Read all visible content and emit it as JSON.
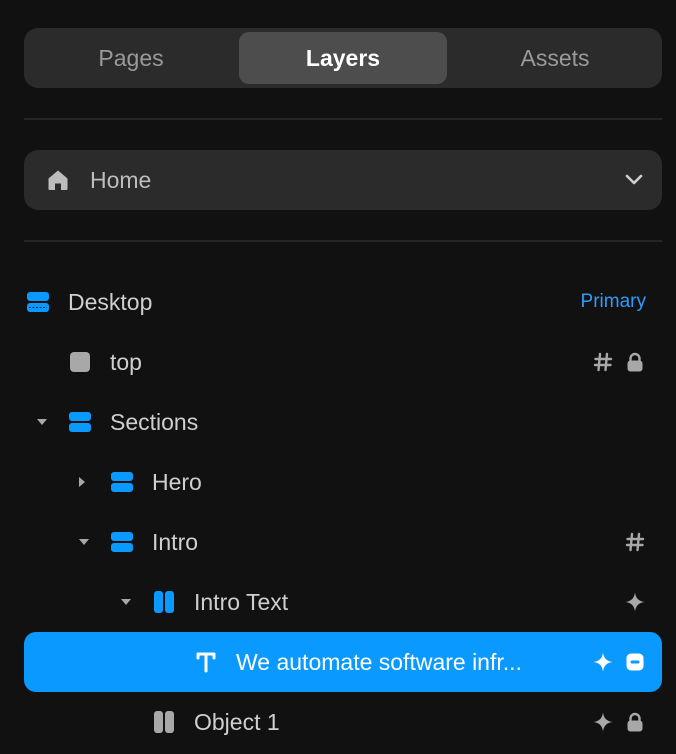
{
  "tabs": [
    {
      "label": "Pages",
      "active": false
    },
    {
      "label": "Layers",
      "active": true
    },
    {
      "label": "Assets",
      "active": false
    }
  ],
  "page_selector": {
    "icon": "home-icon",
    "label": "Home",
    "dropdown_icon": "chevron-down-icon"
  },
  "layers": [
    {
      "name": "Desktop",
      "type": "stack-horizontal",
      "badge": "Primary",
      "expanded": null,
      "actions": []
    },
    {
      "name": "top",
      "type": "frame",
      "expanded": null,
      "actions": [
        "hash-icon",
        "lock-icon"
      ]
    },
    {
      "name": "Sections",
      "type": "stack-horizontal",
      "expanded": true,
      "actions": []
    },
    {
      "name": "Hero",
      "type": "stack-horizontal",
      "expanded": false,
      "actions": []
    },
    {
      "name": "Intro",
      "type": "stack-horizontal",
      "expanded": true,
      "actions": [
        "hash-icon"
      ]
    },
    {
      "name": "Intro Text",
      "type": "stack-vertical",
      "expanded": true,
      "actions": [
        "sparkle-icon"
      ]
    },
    {
      "name": "We automate software infr...",
      "type": "text",
      "selected": true,
      "actions": [
        "sparkle-icon",
        "toggle-icon"
      ]
    },
    {
      "name": "Object 1",
      "type": "stack-vertical",
      "expanded": null,
      "actions": [
        "sparkle-icon",
        "lock-icon"
      ]
    }
  ],
  "colors": {
    "background": "#111111",
    "selection": "#0a99ff",
    "accent_icon": "#0a99ff",
    "primary_badge": "#2f9bff"
  }
}
